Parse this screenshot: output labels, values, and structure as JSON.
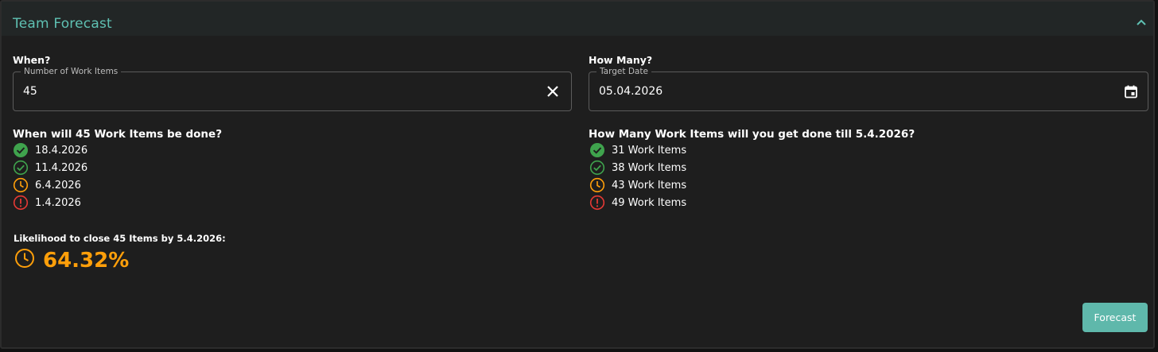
{
  "header": {
    "title": "Team Forecast"
  },
  "left": {
    "label": "When?",
    "field": {
      "legend": "Number of Work Items",
      "value": "45"
    },
    "question": "When will 45 Work Items be done?",
    "results": [
      {
        "text": "18.4.2026",
        "status": "check",
        "color": "#3fa34d"
      },
      {
        "text": "11.4.2026",
        "status": "check-outline",
        "color": "#3fa34d"
      },
      {
        "text": "6.4.2026",
        "status": "clock",
        "color": "#ff9f0a"
      },
      {
        "text": "1.4.2026",
        "status": "alert",
        "color": "#e53935"
      }
    ]
  },
  "right": {
    "label": "How Many?",
    "field": {
      "legend": "Target Date",
      "value": "05.04.2026"
    },
    "question": "How Many Work Items will you get done till 5.4.2026?",
    "results": [
      {
        "text": "31 Work Items",
        "status": "check",
        "color": "#3fa34d"
      },
      {
        "text": "38 Work Items",
        "status": "check-outline",
        "color": "#3fa34d"
      },
      {
        "text": "43 Work Items",
        "status": "clock",
        "color": "#ff9f0a"
      },
      {
        "text": "49 Work Items",
        "status": "alert",
        "color": "#e53935"
      }
    ]
  },
  "likelihood": {
    "label": "Likelihood to close 45 Items by 5.4.2026:",
    "value": "64.32%",
    "icon": "clock-icon",
    "color": "#ff9f0a"
  },
  "forecast_button": {
    "label": "Forecast"
  },
  "colors": {
    "accent": "#5fc1b3",
    "button": "#5fb8ab",
    "success": "#3fa34d",
    "warning": "#ff9f0a",
    "danger": "#e53935"
  }
}
